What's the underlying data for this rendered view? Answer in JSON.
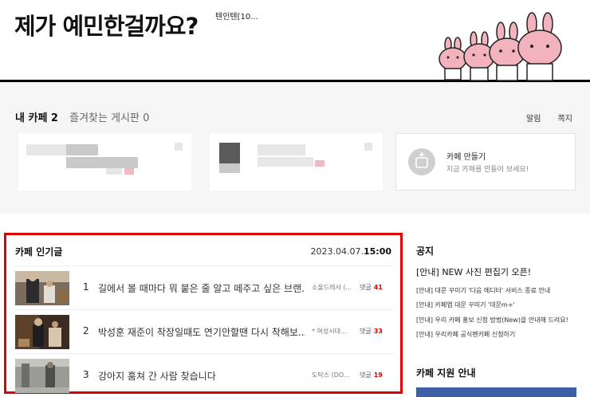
{
  "header": {
    "headline": "제가 예민한걸까요?",
    "source": "텐인텐[10..."
  },
  "my_cafe": {
    "tab_my_cafe": "내 카페 2",
    "tab_favorites": "즐겨찾는 게시판 0",
    "link_alarm": "알림",
    "link_note": "쪽지",
    "create": {
      "title": "카페 만들기",
      "desc": "지금 카페를 만들어 보세요!",
      "icon": "add-cafe-icon"
    }
  },
  "popular": {
    "title": "카페 인기글",
    "date": "2023.04.07.",
    "time": "15:00",
    "posts": [
      {
        "rank": "1",
        "title": "길에서 볼 때마다 뭐 붙은 줄 알고 떼주고 싶은 브랜...",
        "author": "소울드레서 (...",
        "comment_label": "댓글",
        "comments": "41"
      },
      {
        "rank": "2",
        "title": "박성훈 재준이 착장일때도 연기안할땐 다시 착해보...",
        "author": "* 여성시대...",
        "comment_label": "댓글",
        "comments": "33"
      },
      {
        "rank": "3",
        "title": "강아지 훔쳐 간 사람 찾습니다",
        "author": "도탁스 (DO...",
        "comment_label": "댓글",
        "comments": "19"
      }
    ]
  },
  "notice": {
    "title": "공지",
    "featured": "[안내] NEW 사진 편집기 오픈!",
    "items": [
      "[안내] 대문 꾸미기 '다음 에디터' 서비스 종료 안내",
      "[안내] 카페앱 대문 꾸미기 '대문m+'",
      "[안내] 우리 카페 홍보 신청 방법(New)을 안내해 드려요!",
      "[안내] 우리카페 공식펜카페 신청하기"
    ]
  },
  "support": {
    "title": "카페 지원 안내"
  },
  "colors": {
    "highlight_border": "#e00000",
    "comment_count": "#e00000",
    "support_banner": "#3e5fa6"
  }
}
